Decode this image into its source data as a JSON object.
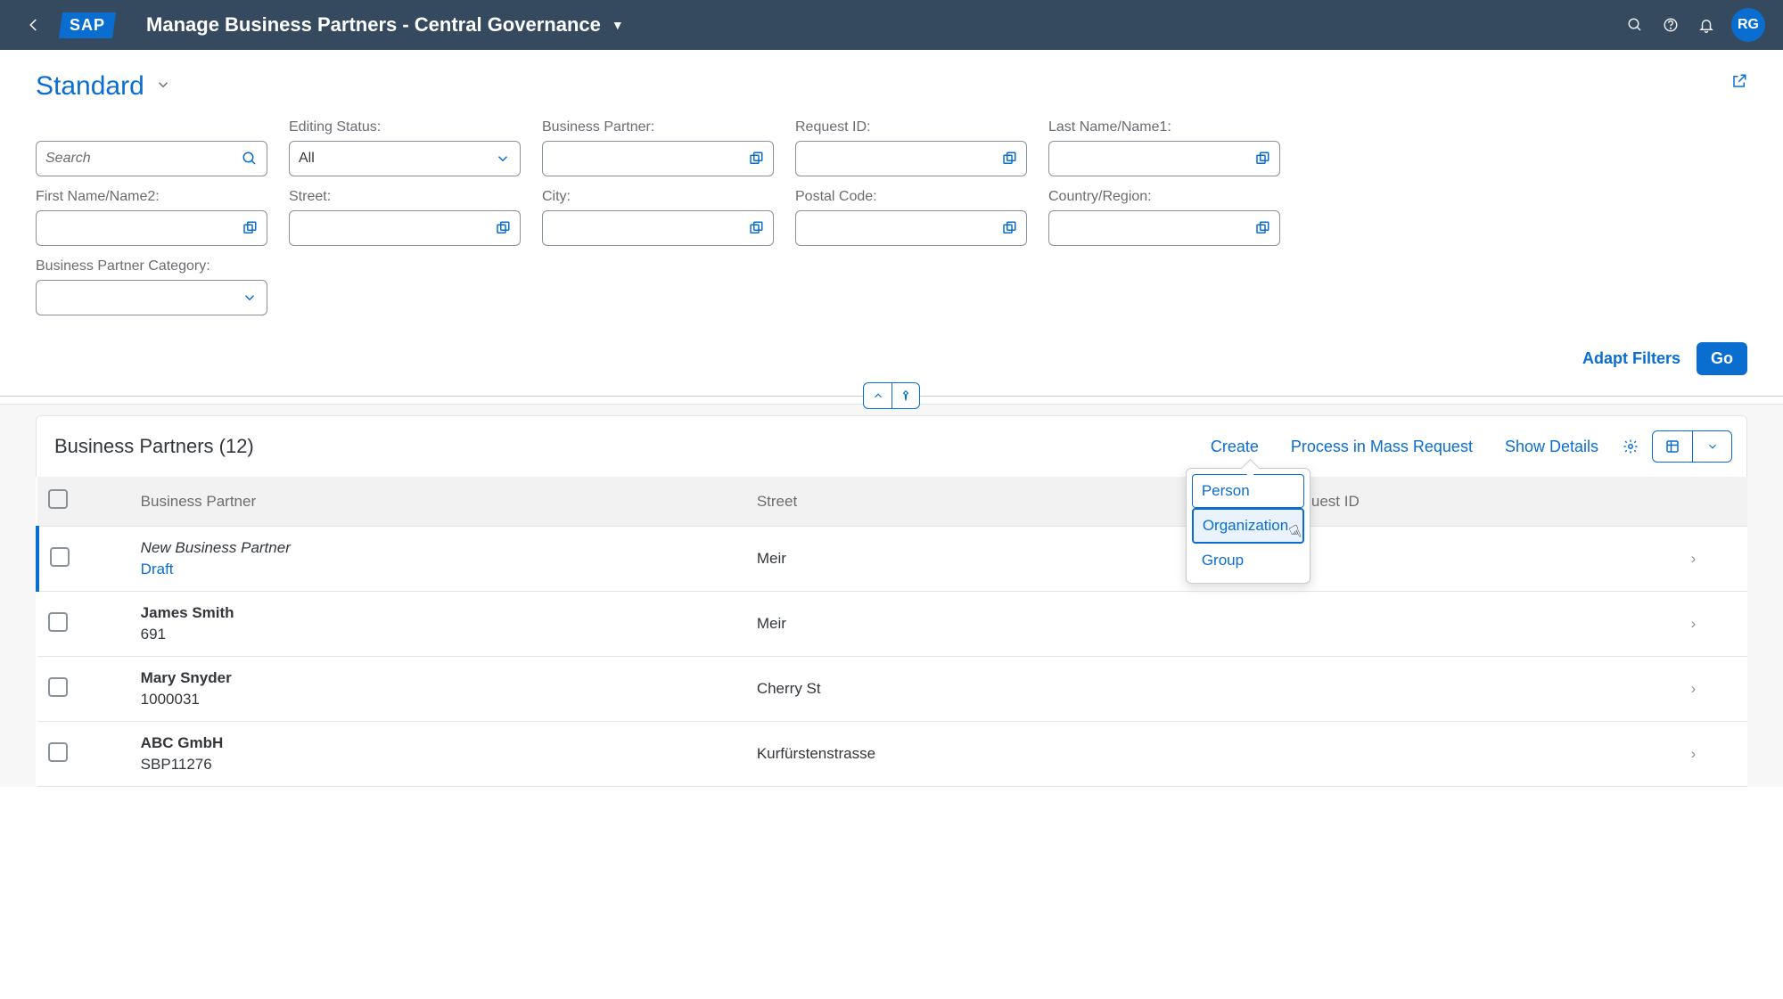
{
  "shell": {
    "title": "Manage Business Partners - Central Governance",
    "avatar": "RG"
  },
  "variant": {
    "name": "Standard"
  },
  "filters": {
    "search_placeholder": "Search",
    "editing_status": {
      "label": "Editing Status:",
      "value": "All"
    },
    "business_partner": {
      "label": "Business Partner:"
    },
    "request_id": {
      "label": "Request ID:"
    },
    "last_name": {
      "label": "Last Name/Name1:"
    },
    "first_name": {
      "label": "First Name/Name2:"
    },
    "street": {
      "label": "Street:"
    },
    "city": {
      "label": "City:"
    },
    "postal_code": {
      "label": "Postal Code:"
    },
    "country": {
      "label": "Country/Region:"
    },
    "bp_category": {
      "label": "Business Partner Category:"
    },
    "adapt_filters": "Adapt Filters",
    "go": "Go"
  },
  "table": {
    "title": "Business Partners (12)",
    "actions": {
      "create": "Create",
      "process_mass": "Process in Mass Request",
      "show_details": "Show Details"
    },
    "create_menu": {
      "person": "Person",
      "organization": "Organization",
      "group": "Group"
    },
    "columns": {
      "bp": "Business Partner",
      "street": "Street",
      "request_id": "uest ID"
    },
    "rows": [
      {
        "name": "New Business Partner",
        "sub": "Draft",
        "street": "Meir",
        "draft": true,
        "italic": true,
        "sublink": true
      },
      {
        "name": "James Smith",
        "sub": "691",
        "street": "Meir"
      },
      {
        "name": "Mary Snyder",
        "sub": "1000031",
        "street": "Cherry St"
      },
      {
        "name": "ABC GmbH",
        "sub": "SBP11276",
        "street": "Kurfürstenstrasse"
      }
    ]
  }
}
